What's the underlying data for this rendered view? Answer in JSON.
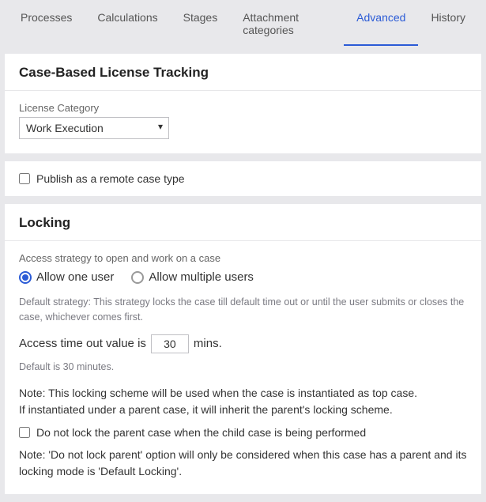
{
  "tabs": {
    "processes": "Processes",
    "calculations": "Calculations",
    "stages": "Stages",
    "attachment_categories": "Attachment categories",
    "advanced": "Advanced",
    "history": "History",
    "active": "advanced"
  },
  "tracking": {
    "title": "Case-Based License Tracking",
    "category_label": "License Category",
    "category_value": "Work Execution"
  },
  "remote": {
    "publish_label": "Publish as a remote case type",
    "publish_checked": false
  },
  "locking": {
    "title": "Locking",
    "access_strategy_label": "Access strategy to open and work on a case",
    "option_one": "Allow one user",
    "option_multiple": "Allow multiple users",
    "selected": "one",
    "default_strategy_hint": "Default strategy: This strategy locks the case till default time out or until the user submits or closes the case, whichever comes first.",
    "timeout_prefix": "Access time out value is",
    "timeout_value": "30",
    "timeout_suffix": "mins.",
    "default_timeout_hint": "Default is 30 minutes.",
    "note_line1": "Note: This locking scheme will be used when the case is instantiated as top case.",
    "note_line2": "If instantiated under a parent case, it will inherit the parent's locking scheme.",
    "do_not_lock_label": "Do not lock the parent case when the child case is being performed",
    "do_not_lock_checked": false,
    "note_lock_parent": "Note: 'Do not lock parent' option will only be considered when this case has a parent and its locking mode is 'Default Locking'."
  }
}
